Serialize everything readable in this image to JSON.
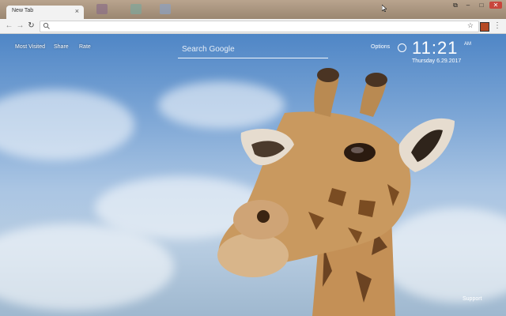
{
  "browser": {
    "tab_title": "New Tab",
    "tab_close": "×",
    "window_controls": {
      "switch": "⧉",
      "minimize": "–",
      "maximize": "□",
      "close": "✕"
    },
    "nav": {
      "back": "←",
      "forward": "→",
      "reload": "↻"
    },
    "star": "☆",
    "menu": "⋮"
  },
  "page": {
    "links": {
      "most_visited": "Most Visited",
      "share": "Share",
      "rate": "Rate"
    },
    "search_placeholder": "Search Google",
    "options_label": "Options",
    "time": "11:21",
    "ampm": "AM",
    "date": "Thursday   6.29.2017",
    "support_label": "Support"
  },
  "colors": {
    "brand_close": "#c8463d",
    "sky": "#6c8fb3"
  }
}
